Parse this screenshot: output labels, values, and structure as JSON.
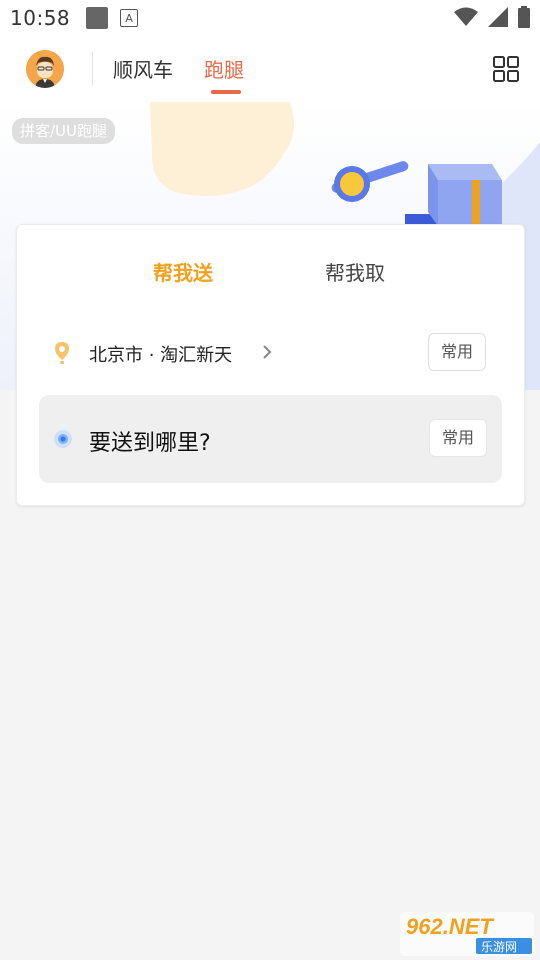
{
  "status_bar": {
    "time": "10:58",
    "icons": [
      "notification-square-icon",
      "text-a-icon",
      "wifi-icon",
      "signal-icon",
      "battery-icon"
    ]
  },
  "nav": {
    "avatar_icon": "user-avatar-icon",
    "tabs": [
      {
        "label": "顺风车",
        "active": false
      },
      {
        "label": "跑腿",
        "active": true
      }
    ],
    "menu_icon": "grid-menu-icon",
    "accent_color": "#e8694a"
  },
  "hero": {
    "tag": "拼客/UU跑腿"
  },
  "card": {
    "tabs": [
      {
        "label": "帮我送",
        "active": true
      },
      {
        "label": "帮我取",
        "active": false
      }
    ],
    "active_color": "#f0a21e",
    "from": {
      "text": "北京市 · 淘汇新天",
      "button": "常用"
    },
    "to": {
      "placeholder": "要送到哪里?",
      "button": "常用"
    }
  },
  "watermark": {
    "top": "962.NET",
    "bottom": "乐游网"
  }
}
